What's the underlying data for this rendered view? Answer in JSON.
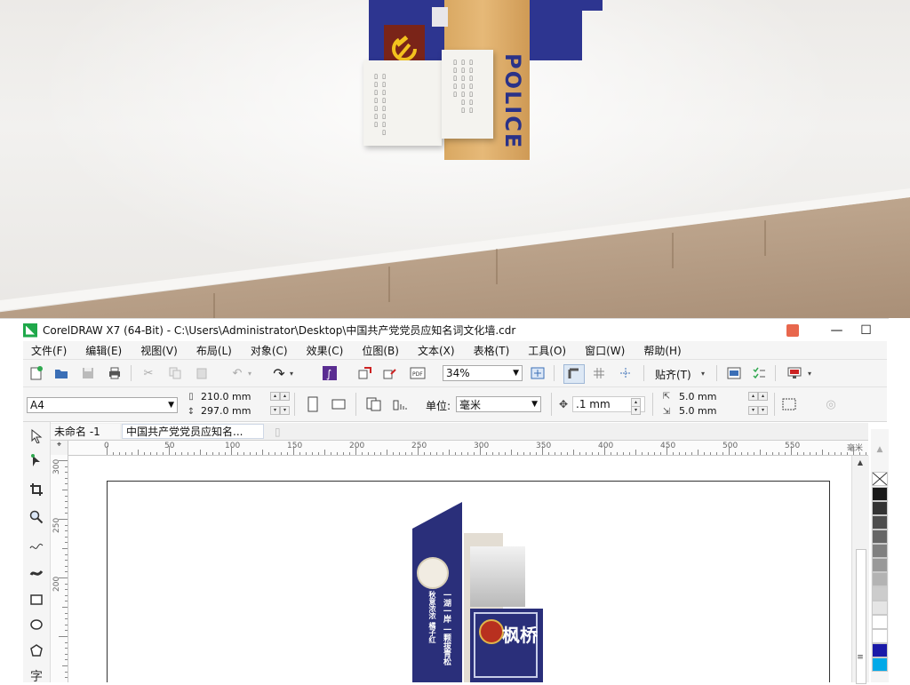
{
  "scene": {
    "sign_text": "POLICE",
    "colors": {
      "wall": "#efedea",
      "floor": "#b89e86",
      "wood": "#e0b26d",
      "blue": "#2d3590",
      "emblem": "#7a2418"
    }
  },
  "window": {
    "title": "CorelDRAW X7 (64-Bit) - C:\\Users\\Administrator\\Desktop\\中国共产党党员应知名词文化墙.cdr",
    "minimize": "—",
    "maximize": "☐",
    "close": "✕"
  },
  "menu": [
    {
      "label": "文件(F)"
    },
    {
      "label": "编辑(E)"
    },
    {
      "label": "视图(V)"
    },
    {
      "label": "布局(L)"
    },
    {
      "label": "对象(C)"
    },
    {
      "label": "效果(C)"
    },
    {
      "label": "位图(B)"
    },
    {
      "label": "文本(X)"
    },
    {
      "label": "表格(T)"
    },
    {
      "label": "工具(O)"
    },
    {
      "label": "窗口(W)"
    },
    {
      "label": "帮助(H)"
    }
  ],
  "toolbar": {
    "zoom": "34%",
    "snap_label": "贴齐(T)"
  },
  "propbar": {
    "page_size": "A4",
    "width": "210.0 mm",
    "height": "297.0 mm",
    "units_label": "单位:",
    "units": "毫米",
    "nudge": ".1 mm",
    "dup_x": "5.0 mm",
    "dup_y": "5.0 mm"
  },
  "doc_tabs": [
    {
      "label": "未命名 -1"
    },
    {
      "label": "中国共产党党员应知名..."
    }
  ],
  "ruler": {
    "unit": "毫米",
    "h_labels": [
      "0",
      "50",
      "100",
      "150",
      "200",
      "250",
      "300",
      "350",
      "400",
      "450",
      "500",
      "550"
    ],
    "v_labels": [
      "300",
      "250",
      "200"
    ]
  },
  "design": {
    "text_col1": "秋意浓浓 橘子红",
    "text_col2": "一湖一岸 一颗拔青松",
    "box_text": "枫桥"
  },
  "palette": [
    "#ffffff",
    "#1a1a1a",
    "#333333",
    "#4d4d4d",
    "#666666",
    "#808080",
    "#999999",
    "#b3b3b3",
    "#cccccc",
    "#e5e5e5",
    "#ffffff",
    "#ffffff",
    "#1a1aa8",
    "#00a9e8"
  ]
}
